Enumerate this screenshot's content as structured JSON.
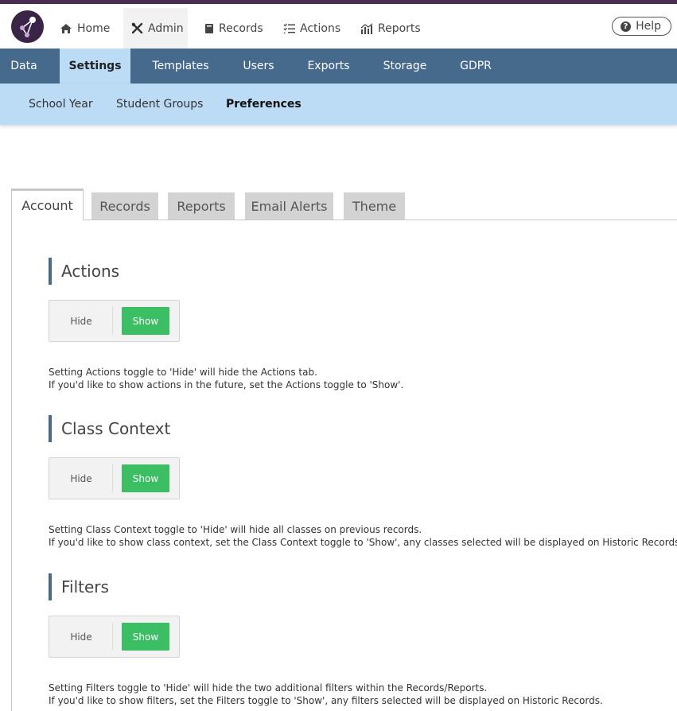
{
  "nav": {
    "items": [
      {
        "label": "Home",
        "icon": "home-icon"
      },
      {
        "label": "Admin",
        "icon": "tools-icon"
      },
      {
        "label": "Records",
        "icon": "book-icon"
      },
      {
        "label": "Actions",
        "icon": "list-check-icon"
      },
      {
        "label": "Reports",
        "icon": "chart-icon"
      }
    ],
    "help_label": "Help"
  },
  "admin_tabs": [
    "Data",
    "Settings",
    "Templates",
    "Users",
    "Exports",
    "Storage",
    "GDPR"
  ],
  "settings_tabs": [
    "School Year",
    "Student Groups",
    "Preferences"
  ],
  "pref_tabs": [
    "Account",
    "Records",
    "Reports",
    "Email Alerts",
    "Theme"
  ],
  "sections": [
    {
      "title": "Actions",
      "hide": "Hide",
      "show": "Show",
      "line1": "Setting Actions toggle to 'Hide' will hide the Actions tab.",
      "line2": "If you'd like to show actions in the future, set the Actions toggle to 'Show'."
    },
    {
      "title": "Class Context",
      "hide": "Hide",
      "show": "Show",
      "line1": "Setting Class Context toggle to 'Hide' will hide all classes on previous records.",
      "line2": "If you'd like to show class context, set the Class Context toggle to 'Show', any classes selected will be displayed on Historic Records."
    },
    {
      "title": "Filters",
      "hide": "Hide",
      "show": "Show",
      "line1": "Setting Filters toggle to 'Hide' will hide the two additional filters within the Records/Reports.",
      "line2": "If you'd like to show filters, set the Filters toggle to 'Show', any filters selected will be displayed on Historic Records."
    }
  ],
  "colors": {
    "brand": "#4a2c52",
    "admin_bar": "#466a8c",
    "sub_bar": "#bcdcf6",
    "show_green": "#3cbf64"
  }
}
